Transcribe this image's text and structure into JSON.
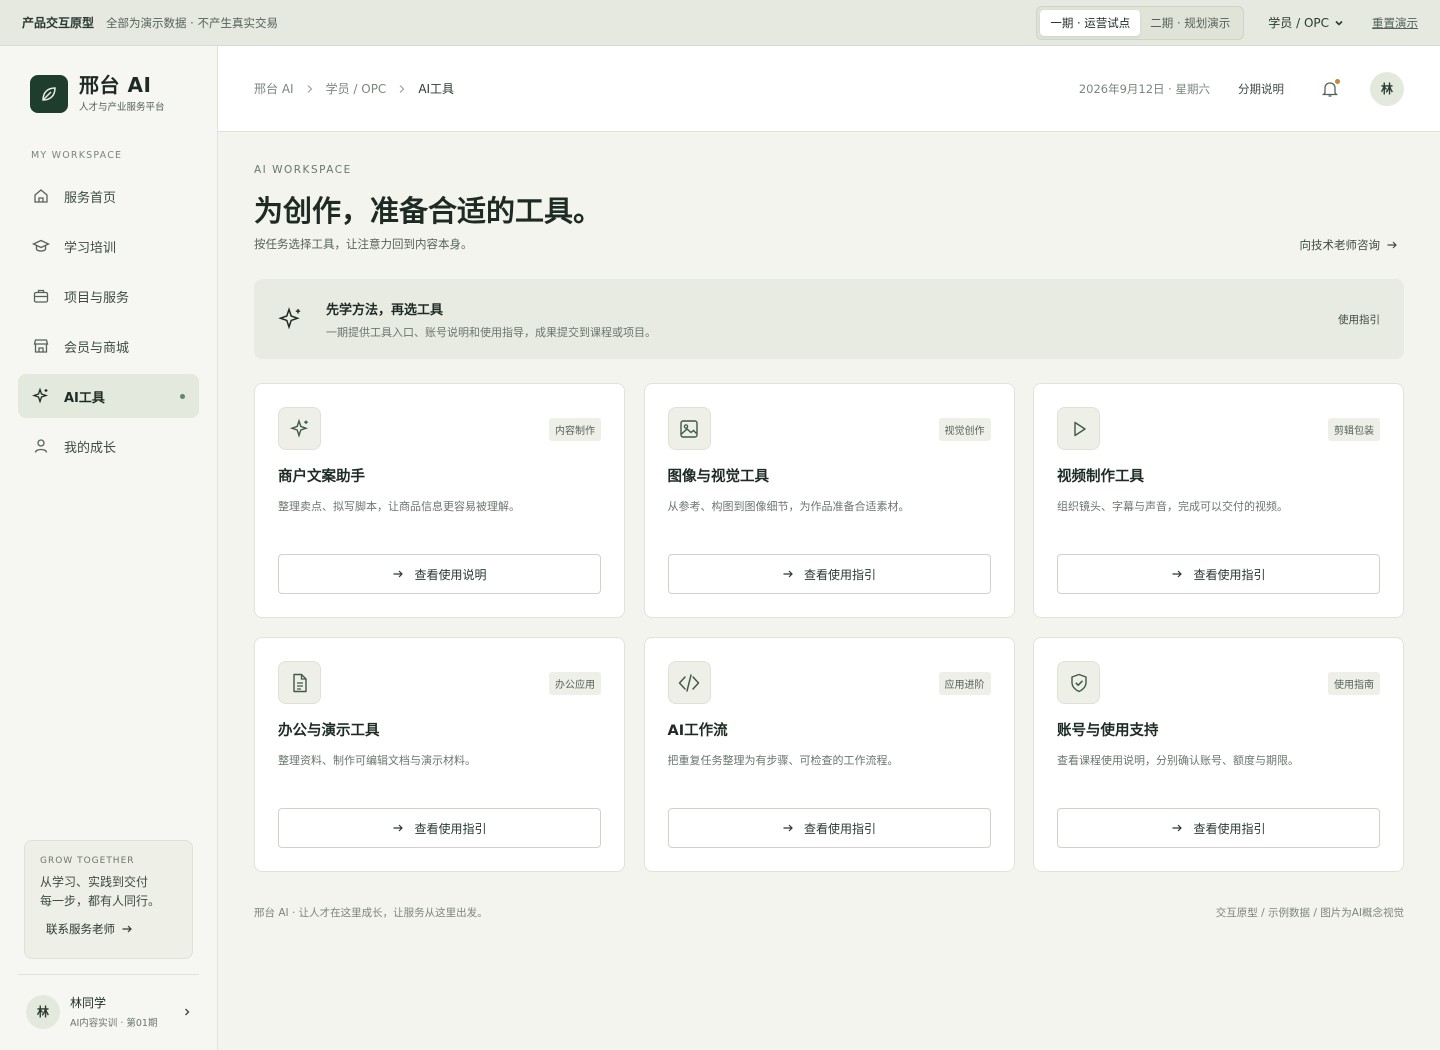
{
  "topbar": {
    "proto_label": "产品交互原型",
    "note": "全部为演示数据 · 不产生真实交易",
    "phases": [
      "一期 · 运营试点",
      "二期 · 规划演示"
    ],
    "active_phase": "一期 · 运营试点",
    "role": "学员 / OPC",
    "reset": "重置演示"
  },
  "brand": {
    "name": "邢台 AI",
    "subtitle": "人才与产业服务平台"
  },
  "sidebar": {
    "workspace_label": "MY WORKSPACE",
    "items": [
      {
        "label": "服务首页",
        "icon": "home-icon"
      },
      {
        "label": "学习培训",
        "icon": "graduation-cap-icon"
      },
      {
        "label": "项目与服务",
        "icon": "briefcase-icon"
      },
      {
        "label": "会员与商城",
        "icon": "store-icon"
      },
      {
        "label": "AI工具",
        "icon": "sparkle-icon",
        "active": true
      },
      {
        "label": "我的成长",
        "icon": "user-icon"
      }
    ],
    "grow": {
      "kicker": "GROW TOGETHER",
      "line1": "从学习、实践到交付",
      "line2": "每一步，都有人同行。",
      "link": "联系服务老师"
    },
    "user": {
      "avatar": "林",
      "name": "林同学",
      "meta": "AI内容实训 · 第01期"
    }
  },
  "header": {
    "crumbs": [
      "邢台 AI",
      "学员 / OPC",
      "AI工具"
    ],
    "date": "2026年9月12日 · 星期六",
    "link": "分期说明",
    "avatar": "林"
  },
  "main": {
    "eyebrow": "AI WORKSPACE",
    "title": "为创作，准备合适的工具。",
    "subtitle": "按任务选择工具，让注意力回到内容本身。",
    "consult": "向技术老师咨询"
  },
  "tip": {
    "title": "先学方法，再选工具",
    "desc": "一期提供工具入口、账号说明和使用指导，成果提交到课程或项目。",
    "guide": "使用指引"
  },
  "tools": [
    {
      "icon": "sparkle-icon",
      "tag": "内容制作",
      "title": "商户文案助手",
      "desc": "整理卖点、拟写脚本，让商品信息更容易被理解。",
      "button": "查看使用说明"
    },
    {
      "icon": "image-icon",
      "tag": "视觉创作",
      "title": "图像与视觉工具",
      "desc": "从参考、构图到图像细节，为作品准备合适素材。",
      "button": "查看使用指引"
    },
    {
      "icon": "play-icon",
      "tag": "剪辑包装",
      "title": "视频制作工具",
      "desc": "组织镜头、字幕与声音，完成可以交付的视频。",
      "button": "查看使用指引"
    },
    {
      "icon": "document-icon",
      "tag": "办公应用",
      "title": "办公与演示工具",
      "desc": "整理资料、制作可编辑文档与演示材料。",
      "button": "查看使用指引"
    },
    {
      "icon": "code-icon",
      "tag": "应用进阶",
      "title": "AI工作流",
      "desc": "把重复任务整理为有步骤、可检查的工作流程。",
      "button": "查看使用指引"
    },
    {
      "icon": "shield-check-icon",
      "tag": "使用指南",
      "title": "账号与使用支持",
      "desc": "查看课程使用说明，分别确认账号、额度与期限。",
      "button": "查看使用指引"
    }
  ],
  "footer": {
    "left": "邢台 AI · 让人才在这里成长，让服务从这里出发。",
    "right": "交互原型 / 示例数据 / 图片为AI概念视觉"
  },
  "colors": {
    "accent": "#1f3d2c",
    "active_bg": "#e4e9dd",
    "page_bg": "#f4f4ef",
    "dot": "#5b8a63"
  }
}
